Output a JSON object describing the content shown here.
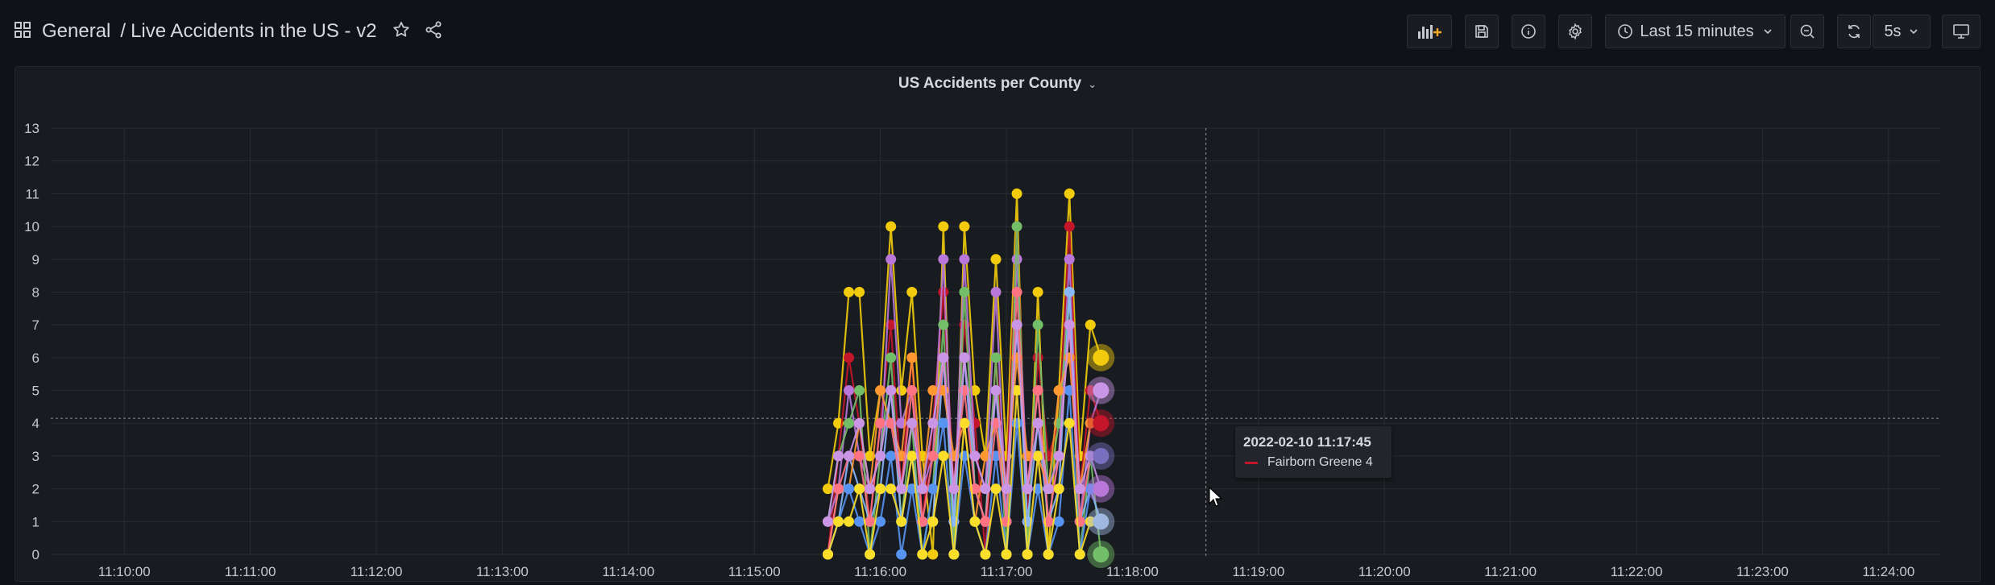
{
  "header": {
    "breadcrumb_folder": "General",
    "breadcrumb_separator": "/",
    "dashboard_title": "Live Accidents in the US - v2"
  },
  "toolbar": {
    "time_range": "Last 15 minutes",
    "refresh_interval": "5s",
    "icons": [
      "add-panel-icon",
      "save-icon",
      "info-icon",
      "settings-icon",
      "clock-icon",
      "zoom-out-icon",
      "refresh-icon",
      "tv-mode-icon"
    ]
  },
  "panel": {
    "title": "US Accidents per County"
  },
  "tooltip": {
    "time": "2022-02-10 11:17:45",
    "series_label": "Fairborn Greene 4",
    "series_color": "#c4162a"
  },
  "chart_data": {
    "type": "line",
    "x_ticks": [
      "11:10:00",
      "11:11:00",
      "11:12:00",
      "11:13:00",
      "11:14:00",
      "11:15:00",
      "11:16:00",
      "11:17:00",
      "11:18:00",
      "11:19:00",
      "11:20:00",
      "11:21:00",
      "11:22:00",
      "11:23:00",
      "11:24:00"
    ],
    "y_ticks": [
      0,
      1,
      2,
      3,
      4,
      5,
      6,
      7,
      8,
      9,
      10,
      11,
      13,
      12
    ],
    "ylim": [
      0,
      13
    ],
    "x_range": [
      "11:09:25",
      "11:24:25"
    ],
    "crosshair": {
      "x": "11:18:35",
      "y": 4.15
    },
    "grid": true,
    "series_x": [
      "11:15:35",
      "11:15:40",
      "11:15:45",
      "11:15:50",
      "11:15:55",
      "11:16:00",
      "11:16:05",
      "11:16:10",
      "11:16:15",
      "11:16:20",
      "11:16:25",
      "11:16:30",
      "11:16:35",
      "11:16:40",
      "11:16:45",
      "11:16:50",
      "11:16:55",
      "11:17:00",
      "11:17:05",
      "11:17:10",
      "11:17:15",
      "11:17:20",
      "11:17:25",
      "11:17:30",
      "11:17:35",
      "11:17:40",
      "11:17:45"
    ],
    "series": [
      {
        "color": "#f2cc0c",
        "values": [
          2,
          4,
          8,
          8,
          3,
          5,
          10,
          5,
          8,
          3,
          0,
          10,
          0,
          10,
          5,
          3,
          9,
          3,
          11,
          0,
          8,
          0,
          5,
          11,
          3,
          7,
          6
        ]
      },
      {
        "color": "#c4162a",
        "values": [
          0,
          3,
          6,
          4,
          1,
          4,
          7,
          2,
          6,
          1,
          4,
          8,
          2,
          7,
          4,
          0,
          6,
          2,
          10,
          1,
          6,
          3,
          4,
          10,
          2,
          5,
          4
        ]
      },
      {
        "color": "#b877d9",
        "values": [
          1,
          2,
          5,
          3,
          2,
          3,
          9,
          4,
          5,
          2,
          3,
          9,
          1,
          9,
          3,
          2,
          8,
          1,
          9,
          2,
          5,
          1,
          3,
          9,
          1,
          4,
          5
        ]
      },
      {
        "color": "#73bf69",
        "values": [
          1,
          3,
          4,
          5,
          0,
          3,
          6,
          1,
          4,
          0,
          2,
          7,
          0,
          8,
          2,
          1,
          6,
          0,
          10,
          0,
          7,
          2,
          4,
          8,
          0,
          3,
          0
        ]
      },
      {
        "color": "#8ab8ff",
        "values": [
          0,
          1,
          3,
          2,
          1,
          2,
          5,
          1,
          3,
          1,
          1,
          6,
          1,
          6,
          2,
          1,
          5,
          1,
          7,
          1,
          4,
          1,
          2,
          8,
          1,
          2,
          1
        ]
      },
      {
        "color": "#ff9830",
        "values": [
          0,
          2,
          2,
          4,
          2,
          5,
          4,
          3,
          6,
          2,
          5,
          5,
          3,
          4,
          1,
          3,
          4,
          2,
          6,
          3,
          3,
          2,
          5,
          6,
          2,
          4,
          4
        ]
      },
      {
        "color": "#5794f2",
        "values": [
          0,
          1,
          2,
          1,
          0,
          1,
          3,
          0,
          2,
          0,
          2,
          4,
          0,
          3,
          1,
          0,
          3,
          0,
          4,
          0,
          2,
          0,
          1,
          5,
          0,
          2,
          2
        ]
      },
      {
        "color": "#ff7383",
        "values": [
          0,
          2,
          3,
          3,
          1,
          4,
          4,
          2,
          5,
          1,
          3,
          6,
          2,
          5,
          2,
          1,
          4,
          1,
          8,
          2,
          5,
          1,
          3,
          7,
          1,
          3,
          3
        ]
      },
      {
        "color": "#fade2a",
        "values": [
          0,
          1,
          1,
          2,
          0,
          2,
          2,
          1,
          3,
          0,
          1,
          3,
          0,
          4,
          1,
          0,
          2,
          0,
          5,
          0,
          3,
          0,
          2,
          4,
          0,
          1,
          1
        ]
      },
      {
        "color": "#ca95e5",
        "values": [
          1,
          3,
          3,
          4,
          2,
          3,
          5,
          2,
          4,
          2,
          4,
          6,
          2,
          6,
          3,
          2,
          5,
          2,
          7,
          2,
          4,
          2,
          3,
          7,
          2,
          3,
          2
        ]
      }
    ],
    "end_markers": [
      {
        "color": "#f2cc0c",
        "value": 6
      },
      {
        "color": "#ca95e5",
        "value": 5
      },
      {
        "color": "#c4162a",
        "value": 4
      },
      {
        "color": "#7a6fbf",
        "value": 3
      },
      {
        "color": "#b877d9",
        "value": 2
      },
      {
        "color": "#a0b8e0",
        "value": 1
      },
      {
        "color": "#73bf69",
        "value": 0
      }
    ]
  }
}
